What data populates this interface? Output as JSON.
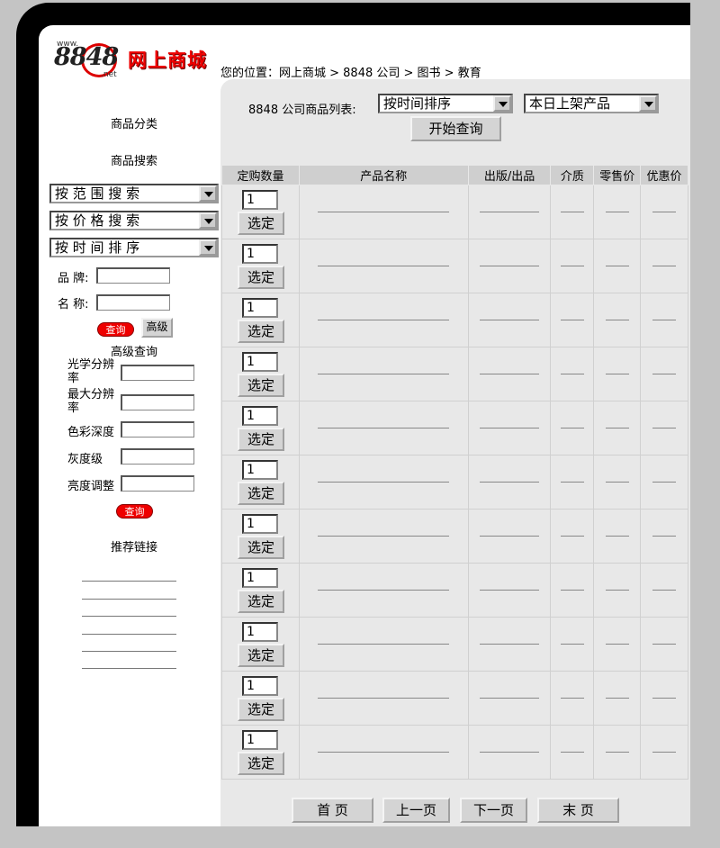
{
  "logo": {
    "www": "www.",
    "number": "8848",
    "net": ".net",
    "name": "网上商城"
  },
  "breadcrumb": "您的位置：网上商城 > 8848 公司 > 图书 > 教育",
  "sidebar": {
    "category_title": "商品分类",
    "search_title": "商品搜索",
    "selects": [
      "按 范 围 搜 索",
      "按 价 格 搜 索",
      "按 时 间 排 序"
    ],
    "brand_label": "品 牌:",
    "name_label": "名 称:",
    "query_button": "查询",
    "advanced_button": "高级",
    "advanced_title": "高级查询",
    "advanced_fields": [
      "光学分辨率",
      "最大分辨率",
      "色彩深度",
      "灰度级",
      "亮度调整"
    ],
    "advanced_query_button": "查询",
    "links_title": "推荐链接"
  },
  "toolbar": {
    "list_label": "8848 公司商品列表:",
    "sort_select": "按时间排序",
    "filter_select": "本日上架产品",
    "start_button": "开始查询"
  },
  "table": {
    "headers": [
      "定购数量",
      "产品名称",
      "出版/出品",
      "介质",
      "零售价",
      "优惠价"
    ],
    "default_qty": "1",
    "select_label": "选定",
    "row_count": 11
  },
  "pager": {
    "first": "首 页",
    "prev": "上一页",
    "next": "下一页",
    "last": "末 页"
  },
  "colors": {
    "frame": "#000000",
    "panel": "#e8e8e8",
    "header": "#cfcfcf",
    "logo_red": "#e00000"
  }
}
